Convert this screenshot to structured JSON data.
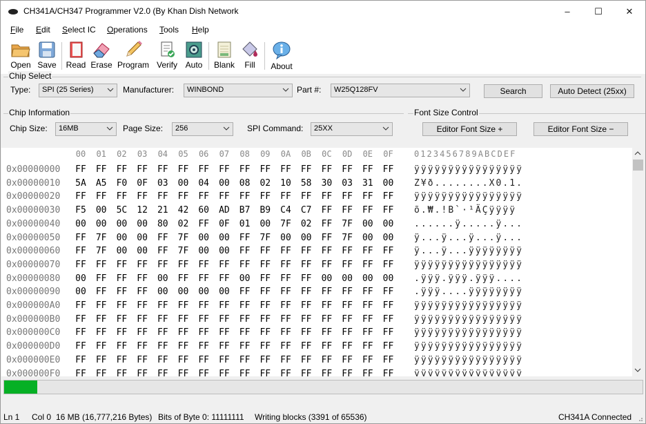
{
  "window": {
    "title": "CH341A/CH347 Programmer V2.0 (By Khan Dish Network",
    "minimize": "–",
    "maximize": "☐",
    "close": "✕"
  },
  "menu": [
    "File",
    "Edit",
    "Select IC",
    "Operations",
    "Tools",
    "Help"
  ],
  "toolbar": {
    "open": "Open",
    "save": "Save",
    "read": "Read",
    "erase": "Erase",
    "program": "Program",
    "verify": "Verify",
    "auto": "Auto",
    "blank": "Blank",
    "fill": "Fill",
    "about": "About"
  },
  "chip_select": {
    "group": "Chip Select",
    "type_label": "Type:",
    "type_value": "SPI (25 Series)",
    "manufacturer_label": "Manufacturer:",
    "manufacturer_value": "WINBOND",
    "part_label": "Part #:",
    "part_value": "W25Q128FV",
    "search": "Search",
    "auto_detect": "Auto Detect (25xx)"
  },
  "chip_info": {
    "group": "Chip Information",
    "size_label": "Chip Size:",
    "size_value": "16MB",
    "page_label": "Page Size:",
    "page_value": "256",
    "cmd_label": "SPI Command:",
    "cmd_value": "25XX"
  },
  "font_size": {
    "group": "Font Size Control",
    "increase": "Editor Font Size +",
    "decrease": "Editor Font Size −"
  },
  "hex": {
    "col_headers": [
      "00",
      "01",
      "02",
      "03",
      "04",
      "05",
      "06",
      "07",
      "08",
      "09",
      "0A",
      "0B",
      "0C",
      "0D",
      "0E",
      "0F"
    ],
    "ascii_header": "0123456789ABCDEF",
    "rows": [
      {
        "addr": "0x00000000",
        "bytes": [
          "FF",
          "FF",
          "FF",
          "FF",
          "FF",
          "FF",
          "FF",
          "FF",
          "FF",
          "FF",
          "FF",
          "FF",
          "FF",
          "FF",
          "FF",
          "FF"
        ],
        "ascii": "ÿÿÿÿÿÿÿÿÿÿÿÿÿÿÿÿ"
      },
      {
        "addr": "0x00000010",
        "bytes": [
          "5A",
          "A5",
          "F0",
          "0F",
          "03",
          "00",
          "04",
          "00",
          "08",
          "02",
          "10",
          "58",
          "30",
          "03",
          "31",
          "00"
        ],
        "ascii": "Z¥ð........X0.1."
      },
      {
        "addr": "0x00000020",
        "bytes": [
          "FF",
          "FF",
          "FF",
          "FF",
          "FF",
          "FF",
          "FF",
          "FF",
          "FF",
          "FF",
          "FF",
          "FF",
          "FF",
          "FF",
          "FF",
          "FF"
        ],
        "ascii": "ÿÿÿÿÿÿÿÿÿÿÿÿÿÿÿÿ"
      },
      {
        "addr": "0x00000030",
        "bytes": [
          "F5",
          "00",
          "5C",
          "12",
          "21",
          "42",
          "60",
          "AD",
          "B7",
          "B9",
          "C4",
          "C7",
          "FF",
          "FF",
          "FF",
          "FF"
        ],
        "ascii": "õ.₩.!B`·¹ÄÇÿÿÿÿ"
      },
      {
        "addr": "0x00000040",
        "bytes": [
          "00",
          "00",
          "00",
          "00",
          "80",
          "02",
          "FF",
          "0F",
          "01",
          "00",
          "7F",
          "02",
          "FF",
          "7F",
          "00",
          "00"
        ],
        "ascii": "......ÿ.....ÿ..."
      },
      {
        "addr": "0x00000050",
        "bytes": [
          "FF",
          "7F",
          "00",
          "00",
          "FF",
          "7F",
          "00",
          "00",
          "FF",
          "7F",
          "00",
          "00",
          "FF",
          "7F",
          "00",
          "00"
        ],
        "ascii": "ÿ...ÿ...ÿ...ÿ..."
      },
      {
        "addr": "0x00000060",
        "bytes": [
          "FF",
          "7F",
          "00",
          "00",
          "FF",
          "7F",
          "00",
          "00",
          "FF",
          "FF",
          "FF",
          "FF",
          "FF",
          "FF",
          "FF",
          "FF"
        ],
        "ascii": "ÿ...ÿ...ÿÿÿÿÿÿÿÿ"
      },
      {
        "addr": "0x00000070",
        "bytes": [
          "FF",
          "FF",
          "FF",
          "FF",
          "FF",
          "FF",
          "FF",
          "FF",
          "FF",
          "FF",
          "FF",
          "FF",
          "FF",
          "FF",
          "FF",
          "FF"
        ],
        "ascii": "ÿÿÿÿÿÿÿÿÿÿÿÿÿÿÿÿ"
      },
      {
        "addr": "0x00000080",
        "bytes": [
          "00",
          "FF",
          "FF",
          "FF",
          "00",
          "FF",
          "FF",
          "FF",
          "00",
          "FF",
          "FF",
          "FF",
          "00",
          "00",
          "00",
          "00"
        ],
        "ascii": ".ÿÿÿ.ÿÿÿ.ÿÿÿ...."
      },
      {
        "addr": "0x00000090",
        "bytes": [
          "00",
          "FF",
          "FF",
          "FF",
          "00",
          "00",
          "00",
          "00",
          "FF",
          "FF",
          "FF",
          "FF",
          "FF",
          "FF",
          "FF",
          "FF"
        ],
        "ascii": ".ÿÿÿ....ÿÿÿÿÿÿÿÿ"
      },
      {
        "addr": "0x000000A0",
        "bytes": [
          "FF",
          "FF",
          "FF",
          "FF",
          "FF",
          "FF",
          "FF",
          "FF",
          "FF",
          "FF",
          "FF",
          "FF",
          "FF",
          "FF",
          "FF",
          "FF"
        ],
        "ascii": "ÿÿÿÿÿÿÿÿÿÿÿÿÿÿÿÿ"
      },
      {
        "addr": "0x000000B0",
        "bytes": [
          "FF",
          "FF",
          "FF",
          "FF",
          "FF",
          "FF",
          "FF",
          "FF",
          "FF",
          "FF",
          "FF",
          "FF",
          "FF",
          "FF",
          "FF",
          "FF"
        ],
        "ascii": "ÿÿÿÿÿÿÿÿÿÿÿÿÿÿÿÿ"
      },
      {
        "addr": "0x000000C0",
        "bytes": [
          "FF",
          "FF",
          "FF",
          "FF",
          "FF",
          "FF",
          "FF",
          "FF",
          "FF",
          "FF",
          "FF",
          "FF",
          "FF",
          "FF",
          "FF",
          "FF"
        ],
        "ascii": "ÿÿÿÿÿÿÿÿÿÿÿÿÿÿÿÿ"
      },
      {
        "addr": "0x000000D0",
        "bytes": [
          "FF",
          "FF",
          "FF",
          "FF",
          "FF",
          "FF",
          "FF",
          "FF",
          "FF",
          "FF",
          "FF",
          "FF",
          "FF",
          "FF",
          "FF",
          "FF"
        ],
        "ascii": "ÿÿÿÿÿÿÿÿÿÿÿÿÿÿÿÿ"
      },
      {
        "addr": "0x000000E0",
        "bytes": [
          "FF",
          "FF",
          "FF",
          "FF",
          "FF",
          "FF",
          "FF",
          "FF",
          "FF",
          "FF",
          "FF",
          "FF",
          "FF",
          "FF",
          "FF",
          "FF"
        ],
        "ascii": "ÿÿÿÿÿÿÿÿÿÿÿÿÿÿÿÿ"
      },
      {
        "addr": "0x000000F0",
        "bytes": [
          "FF",
          "FF",
          "FF",
          "FF",
          "FF",
          "FF",
          "FF",
          "FF",
          "FF",
          "FF",
          "FF",
          "FF",
          "FF",
          "FF",
          "FF",
          "FF"
        ],
        "ascii": "ÿÿÿÿÿÿÿÿÿÿÿÿÿÿÿÿ"
      }
    ]
  },
  "progress": {
    "fraction": 0.0517,
    "color": "#06b025"
  },
  "status": {
    "line": "Ln 1",
    "col": "Col 0",
    "size": "16 MB (16,777,216 Bytes)",
    "bits": "Bits of Byte 0: 11111111",
    "activity": "Writing blocks (3391 of 65536)",
    "connection": "CH341A Connected"
  }
}
